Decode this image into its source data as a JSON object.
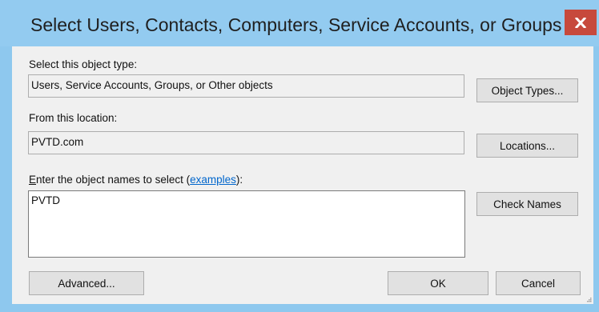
{
  "window": {
    "title": "Select Users, Contacts, Computers, Service Accounts, or Groups",
    "close_glyph": "x"
  },
  "object_type": {
    "label": "Select this object type:",
    "value": "Users, Service Accounts, Groups, or Other objects",
    "button": "Object Types..."
  },
  "location": {
    "label": "From this location:",
    "value": "PVTD.com",
    "button": "Locations..."
  },
  "names": {
    "label_accel": "E",
    "label_rest": "nter the object names to select (",
    "link": "examples",
    "label_end": "):",
    "value": "PVTD",
    "check_button": "Check Names"
  },
  "footer": {
    "advanced_button": "Advanced...",
    "ok_button": "OK",
    "cancel_button": "Cancel"
  },
  "colors": {
    "titlebar": "#93cbf0",
    "close": "#c7493c",
    "client": "#f0f0f0",
    "link": "#0066cc"
  }
}
